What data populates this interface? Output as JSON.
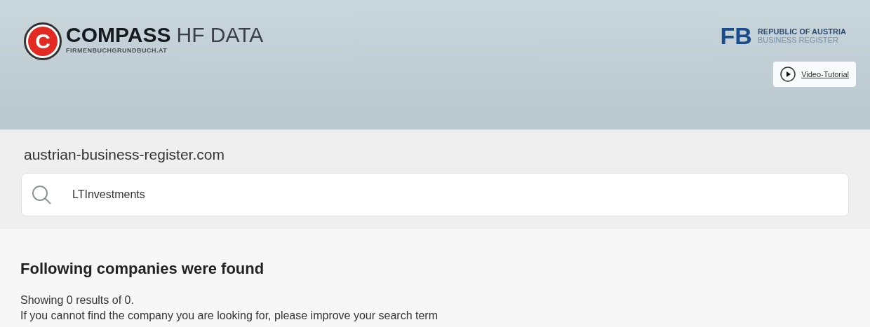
{
  "header": {
    "logo_letter": "C",
    "brand_bold": "COMPASS",
    "brand_light": "HF DATA",
    "brand_sub": "FIRMENBUCHGRUNDBUCH.AT",
    "register_mark": "FB",
    "register_line1": "REPUBLIC OF AUSTRIA",
    "register_line2": "BUSINESS REGISTER",
    "tutorial_link": "Video-Tutorial"
  },
  "search": {
    "site": "austrian-business-register.com",
    "value": "LTInvestments"
  },
  "results": {
    "heading": "Following companies were found",
    "count": "Showing 0 results of 0.",
    "hint": "If you cannot find the company you are looking for, please improve your search term"
  }
}
